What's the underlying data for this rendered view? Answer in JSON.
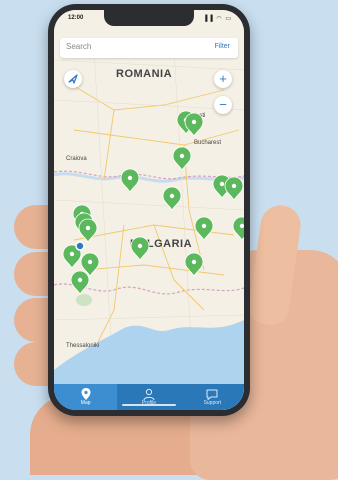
{
  "status": {
    "time": "12:00",
    "icons": "▐▐ ◠ ▭"
  },
  "search": {
    "placeholder": "Search",
    "filter_label": "Filter"
  },
  "map": {
    "countries": [
      "ROMANIA",
      "BULGARIA"
    ],
    "cities": [
      "Ploiesti",
      "Bucharest",
      "Craiova",
      "Thessaloniki"
    ],
    "location_icon": "navigation-arrow-icon",
    "zoom_in_label": "+",
    "zoom_out_label": "−",
    "marker_color": "#5cb85c",
    "user_location_color": "#2f78c6"
  },
  "tabs": [
    {
      "label": "Map",
      "icon": "map-pin-icon",
      "active": true
    },
    {
      "label": "Profile",
      "icon": "user-icon",
      "active": false
    },
    {
      "label": "Support",
      "icon": "chat-icon",
      "active": false
    }
  ],
  "colors": {
    "background": "#c9dff0",
    "tabbar": "#2a78b8",
    "accent": "#2f78c6",
    "sea": "#aed3ef"
  }
}
